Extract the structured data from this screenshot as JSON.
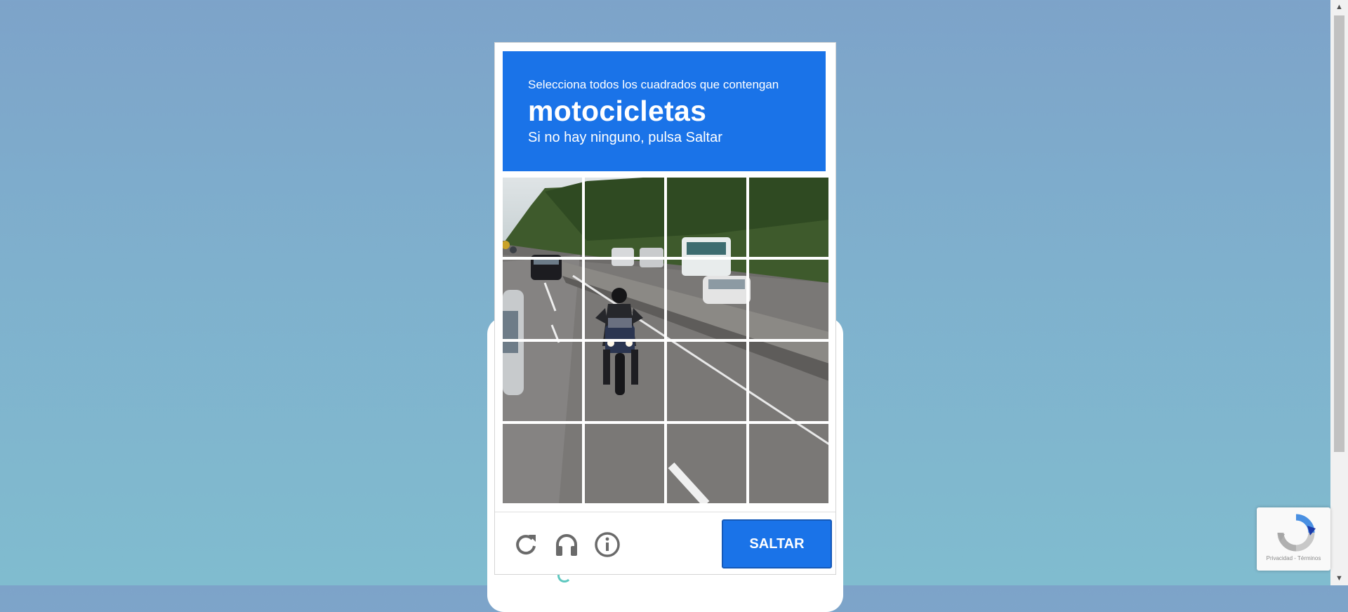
{
  "challenge": {
    "instruction": "Selecciona todos los cuadrados que contengan",
    "target_object": "motocicletas",
    "hint": "Si no hay ninguno, pulsa Saltar",
    "grid": {
      "rows": 4,
      "cols": 4,
      "tile_count": 16
    }
  },
  "footer": {
    "reload_icon": "reload-icon",
    "audio_icon": "headphones-icon",
    "info_icon": "info-icon",
    "skip_label": "SALTAR"
  },
  "badge": {
    "logo_icon": "recaptcha-logo-icon",
    "legal_text": "Privacidad - Términos"
  },
  "colors": {
    "accent": "#1a73e8",
    "background_top": "#7da3c9",
    "background_bottom": "#80bccf"
  }
}
